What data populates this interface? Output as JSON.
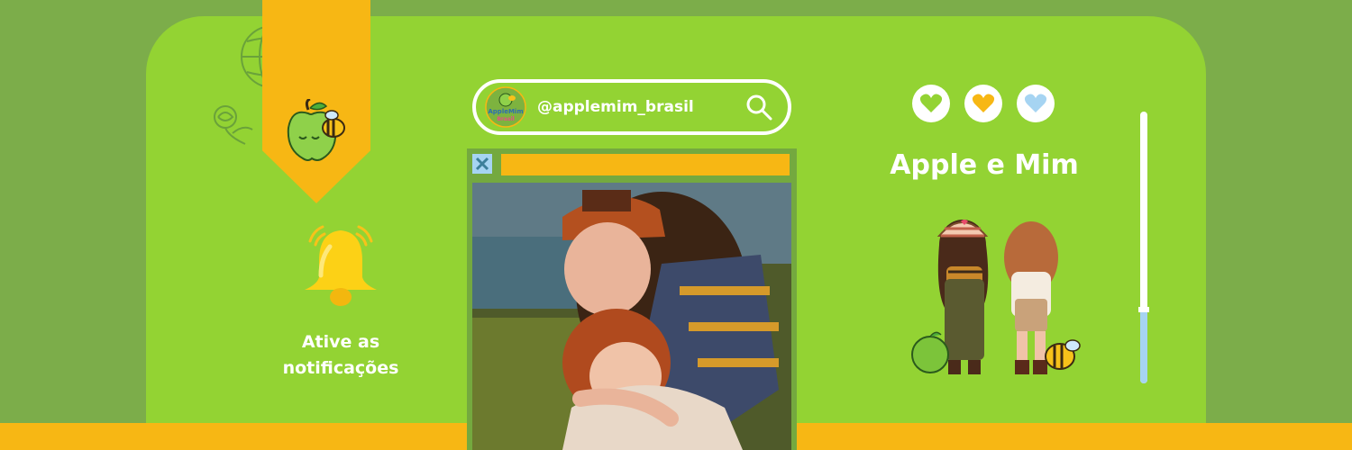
{
  "profile": {
    "handle": "@applemim_brasil",
    "brand_name": "Apple e Mim",
    "logo_text_line1": "AppleMim",
    "logo_text_line2": "Brasil"
  },
  "notification": {
    "line1": "Ative as",
    "line2": "notificações"
  },
  "icons": {
    "search": "search-icon",
    "bell": "bell-icon",
    "close": "close-icon",
    "hearts": [
      "heart-green-icon",
      "heart-yellow-icon",
      "heart-blue-icon"
    ]
  },
  "colors": {
    "background": "#7cad4a",
    "panel": "#93d333",
    "accent_yellow": "#f7b714",
    "accent_blue": "#a6d4f2",
    "heart_green": "#93d333",
    "heart_yellow": "#f7b714",
    "heart_blue": "#a6d4f2"
  },
  "scrollbar": {
    "level": 0.27
  }
}
